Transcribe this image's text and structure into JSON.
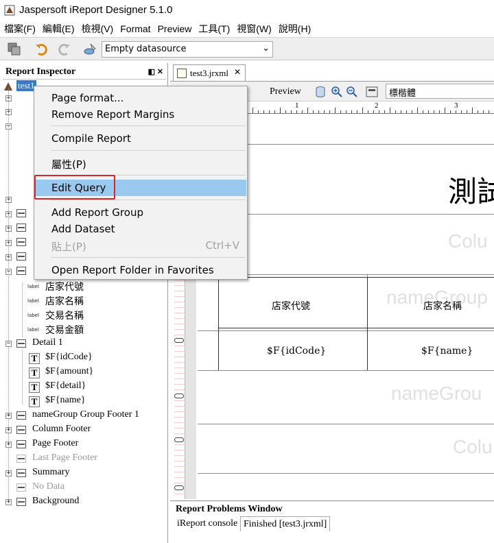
{
  "window": {
    "title": "Jaspersoft iReport Designer 5.1.0"
  },
  "menubar": {
    "items": [
      "檔案(F)",
      "編輯(E)",
      "檢視(V)",
      "Format",
      "Preview",
      "工具(T)",
      "視窗(W)",
      "說明(H)"
    ]
  },
  "toolbar": {
    "datasource": "Empty datasource"
  },
  "inspector": {
    "title": "Report Inspector",
    "root": "test1",
    "labels": [
      "店家代號",
      "店家名稱",
      "交易名稱",
      "交易金額"
    ],
    "detail_band": "Detail 1",
    "fields": [
      "$F{idCode}",
      "$F{amount}",
      "$F{detail}",
      "$F{name}"
    ],
    "bands_after": [
      {
        "label": "nameGroup Group Footer 1",
        "disabled": false
      },
      {
        "label": "Column Footer",
        "disabled": false
      },
      {
        "label": "Page Footer",
        "disabled": false
      },
      {
        "label": "Last Page Footer",
        "disabled": true
      },
      {
        "label": "Summary",
        "disabled": false
      },
      {
        "label": "No Data",
        "disabled": true
      },
      {
        "label": "Background",
        "disabled": false
      }
    ]
  },
  "editor": {
    "tab": "test3.jrxml",
    "preview": "Preview",
    "font": "標楷體",
    "ruler_numbers": [
      "1",
      "2",
      "3"
    ],
    "title_text": "測試",
    "ghost_labels": [
      "Colu",
      "nameGroup",
      "nameGrou",
      "Colu"
    ],
    "headers": [
      "店家代號",
      "店家名稱"
    ],
    "cells": [
      "$F{idCode}",
      "$F{name}"
    ]
  },
  "problems": {
    "title": "Report Problems Window",
    "tabs": [
      "iReport console",
      "Finished [test3.jrxml]"
    ]
  },
  "context_menu": {
    "items": [
      {
        "label": "Page format...",
        "shortcut": "",
        "disabled": false
      },
      {
        "label": "Remove Report Margins",
        "shortcut": "",
        "disabled": false
      },
      {
        "label": "Compile Report",
        "shortcut": "",
        "disabled": false
      },
      {
        "label": "屬性(P)",
        "shortcut": "",
        "disabled": false
      },
      {
        "label": "Edit Query",
        "shortcut": "",
        "disabled": false,
        "highlighted": true
      },
      {
        "label": "Add Report Group",
        "shortcut": "",
        "disabled": false
      },
      {
        "label": "Add Dataset",
        "shortcut": "",
        "disabled": false
      },
      {
        "label": "貼上(P)",
        "shortcut": "Ctrl+V",
        "disabled": true
      },
      {
        "label": "Open Report Folder in Favorites",
        "shortcut": "",
        "disabled": false
      }
    ]
  },
  "colors": {
    "menu_highlight": "#99c9ef",
    "annotation_box": "#d12a2a"
  }
}
